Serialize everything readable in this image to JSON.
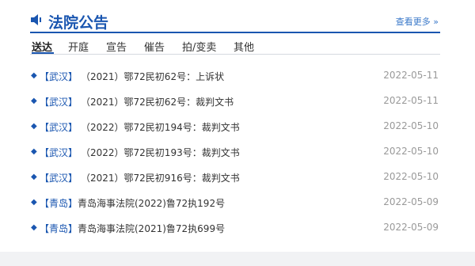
{
  "panel": {
    "title": "法院公告",
    "more_label": "查看更多 »",
    "tabs": [
      {
        "label": "送达",
        "active": true
      },
      {
        "label": "开庭",
        "active": false
      },
      {
        "label": "宣告",
        "active": false
      },
      {
        "label": "催告",
        "active": false
      },
      {
        "label": "拍/变卖",
        "active": false
      },
      {
        "label": "其他",
        "active": false
      }
    ],
    "items": [
      {
        "region": "【武汉】",
        "title": "（2021）鄂72民初62号：上诉状",
        "date": "2022-05-11"
      },
      {
        "region": "【武汉】",
        "title": "（2021）鄂72民初62号：裁判文书",
        "date": "2022-05-11"
      },
      {
        "region": "【武汉】",
        "title": "（2022）鄂72民初194号：裁判文书",
        "date": "2022-05-10"
      },
      {
        "region": "【武汉】",
        "title": "（2022）鄂72民初193号：裁判文书",
        "date": "2022-05-10"
      },
      {
        "region": "【武汉】",
        "title": "（2021）鄂72民初916号：裁判文书",
        "date": "2022-05-10"
      },
      {
        "region": "【青岛】",
        "title": "青岛海事法院(2022)鲁72执192号",
        "date": "2022-05-09"
      },
      {
        "region": "【青岛】",
        "title": "青岛海事法院(2021)鲁72执699号",
        "date": "2022-05-09"
      }
    ],
    "bullet_icon": "diamond-bullet-icon",
    "accent_color": "#1a56b0"
  }
}
